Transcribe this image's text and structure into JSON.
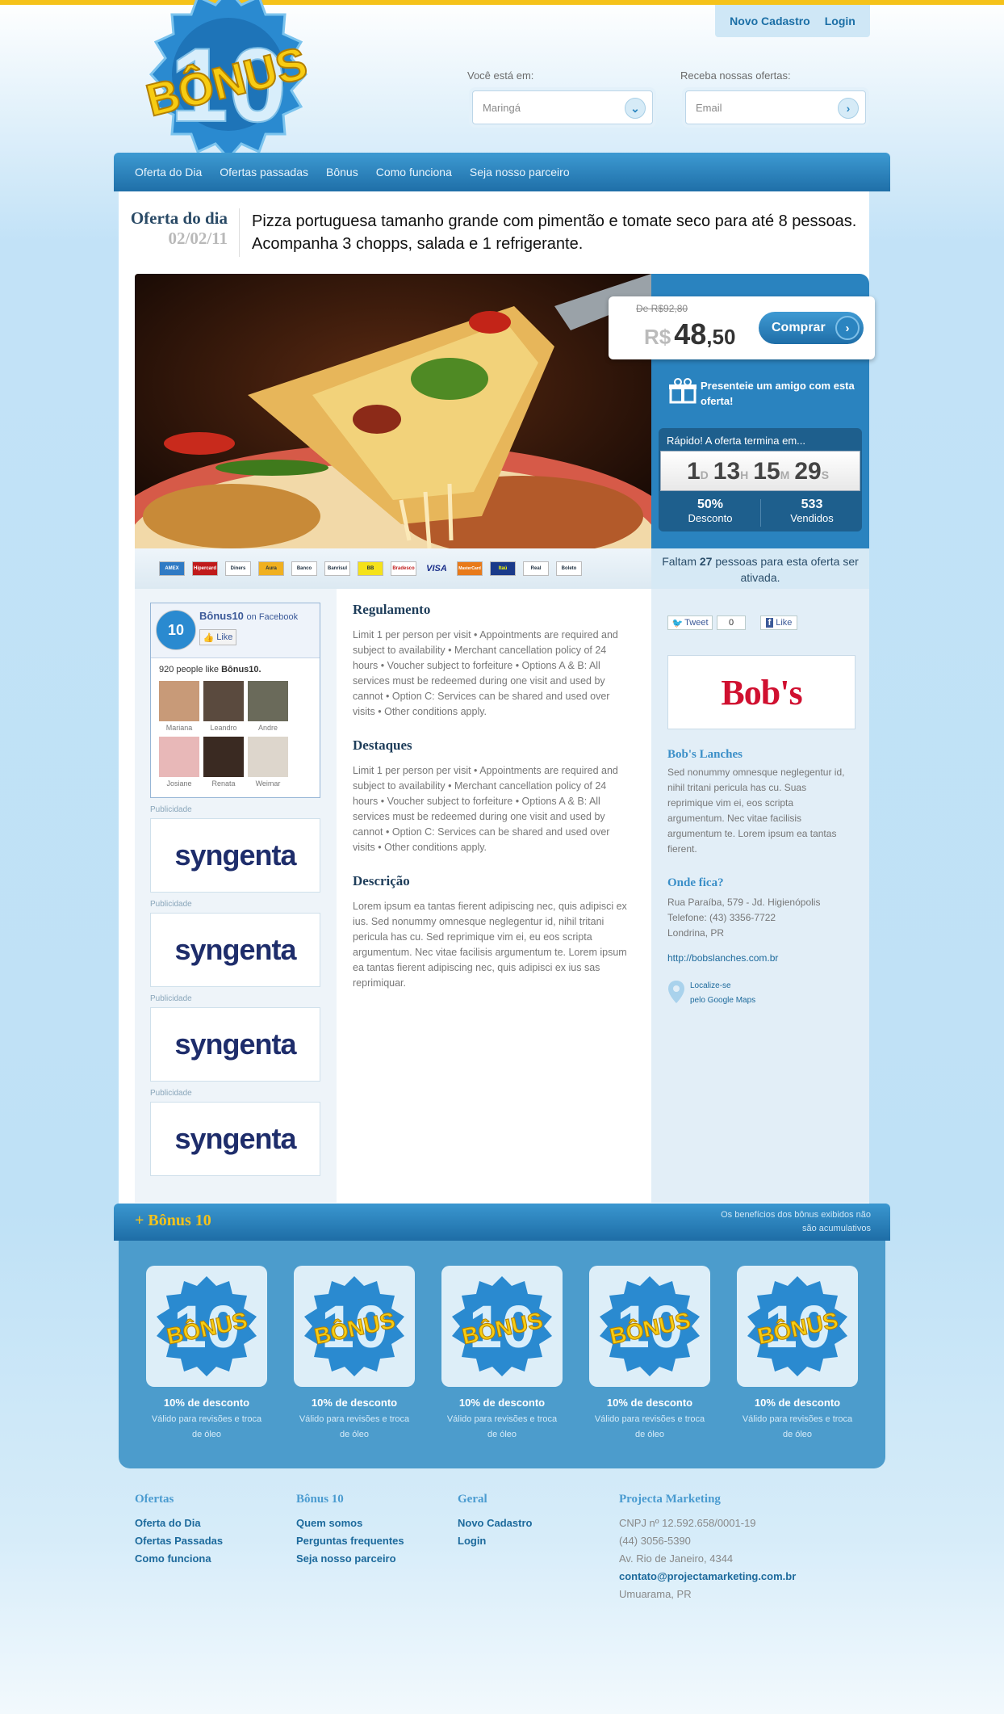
{
  "header": {
    "new_signup": "Novo Cadastro",
    "login": "Login",
    "logo_text": "BÔNUS",
    "logo_number": "10",
    "location_label": "Você está em:",
    "location_value": "Maringá",
    "offers_label": "Receba nossas ofertas:",
    "email_placeholder": "Email"
  },
  "nav": [
    "Oferta do Dia",
    "Ofertas passadas",
    "Bônus",
    "Como funciona",
    "Seja nosso parceiro"
  ],
  "deal": {
    "title": "Oferta do dia",
    "date": "02/02/11",
    "description": "Pizza portuguesa tamanho grande com pimentão e tomate seco para até 8 pessoas. Acompanha 3 chopps, salada e 1 refrigerante.",
    "old_price": "De R$92,80",
    "currency": "R$",
    "price_int": "48",
    "price_cents": ",50",
    "buy_label": "Comprar",
    "gift_text": "Presenteie um amigo com esta oferta!",
    "timer_label": "Rápido! A oferta termina em...",
    "timer": {
      "days": "1",
      "d": "D",
      "hours": "13",
      "h": "H",
      "minutes": "15",
      "m": "M",
      "seconds": "29",
      "s": "S"
    },
    "discount_value": "50%",
    "discount_label": "Desconto",
    "sold_value": "533",
    "sold_label": "Vendidos",
    "remaining_pre": "Faltam",
    "remaining_num": "27",
    "remaining_post": "pessoas para esta oferta ser ativada.",
    "cards": [
      "AMEX",
      "Hipercard",
      "Diners",
      "Aura",
      "Banco",
      "Banrisul",
      "BB",
      "Bradesco",
      "VISA",
      "MasterCard",
      "Itaú",
      "Real",
      "Boleto"
    ]
  },
  "facebook": {
    "page": "Bônus10",
    "on": "on Facebook",
    "like": "Like",
    "count_text": "920 people like",
    "count_page": "Bônus10.",
    "friends": [
      "Mariana",
      "Leandro",
      "Andre",
      "Josiane",
      "Renata",
      "Weimar"
    ]
  },
  "ads": {
    "label": "Publicidade",
    "brand": "syngenta",
    "count": 4
  },
  "content": {
    "rules_title": "Regulamento",
    "rules_text": "Limit 1 per person per visit • Appointments are required and subject to availability • Merchant cancellation policy of 24 hours • Voucher subject to forfeiture • Options A & B: All services must be redeemed during one visit and used by cannot • Option C: Services can be shared and used over visits • Other conditions apply.",
    "highlights_title": "Destaques",
    "highlights_text": "Limit 1 per person per visit • Appointments are required and subject to availability • Merchant cancellation policy of 24 hours • Voucher subject to forfeiture • Options A & B: All services must be redeemed during one visit and used by cannot • Option C: Services can be shared and used over visits • Other conditions apply.",
    "desc_title": "Descrição",
    "desc_text": "Lorem ipsum ea tantas fierent adipiscing nec, quis adipisci ex ius. Sed nonummy omnesque neglegentur id, nihil tritani pericula has cu. Sed reprimique vim ei, eu eos scripta argumentum. Nec vitae facilisis argumentum te. Lorem ipsum ea tantas fierent adipiscing nec, quis adipisci ex ius sas reprimiquar."
  },
  "merchant": {
    "tweet": "Tweet",
    "tweet_count": "0",
    "like": "Like",
    "logo": "Bob's",
    "name": "Bob's Lanches",
    "about": "Sed nonummy omnesque neglegentur id, nihil tritani pericula has cu. Suas reprimique vim ei, eos scripta argumentum. Nec vitae facilisis argumentum te. Lorem ipsum ea tantas fierent.",
    "where_title": "Onde fica?",
    "address1": "Rua Paraíba, 579 - Jd. Higienópolis",
    "phone": "Telefone: (43) 3356-7722",
    "city": "Londrina, PR",
    "url": "http://bobslanches.com.br",
    "map_line1": "Localize-se",
    "map_line2": "pelo Google Maps"
  },
  "bonus": {
    "title": "+ Bônus 10",
    "note_line1": "Os benefícios dos bônus exibidos não",
    "note_line2": "são acumulativos",
    "items": [
      {
        "name": "10% de desconto",
        "sub": "Válido para revisões e troca de óleo"
      },
      {
        "name": "10% de desconto",
        "sub": "Válido para revisões e troca de óleo"
      },
      {
        "name": "10% de desconto",
        "sub": "Válido para revisões e troca de óleo"
      },
      {
        "name": "10% de desconto",
        "sub": "Válido para revisões e troca de óleo"
      },
      {
        "name": "10% de desconto",
        "sub": "Válido para revisões e troca de óleo"
      }
    ]
  },
  "footer": {
    "col1": {
      "title": "Ofertas",
      "links": [
        "Oferta do Dia",
        "Ofertas Passadas",
        "Como funciona"
      ]
    },
    "col2": {
      "title": "Bônus 10",
      "links": [
        "Quem somos",
        "Perguntas frequentes",
        "Seja nosso parceiro"
      ]
    },
    "col3": {
      "title": "Geral",
      "links": [
        "Novo Cadastro",
        "Login"
      ]
    },
    "col4": {
      "title": "Projecta Marketing",
      "cnpj": "CNPJ nº 12.592.658/0001-19",
      "phone": "(44) 3056-5390",
      "address": "Av. Rio de Janeiro, 4344",
      "email": "contato@projectamarketing.com.br",
      "city": "Umuarama, PR"
    }
  },
  "colors": {
    "accent": "#1f6fa8",
    "yellow": "#f5c21a",
    "link": "#1d6a9c"
  }
}
